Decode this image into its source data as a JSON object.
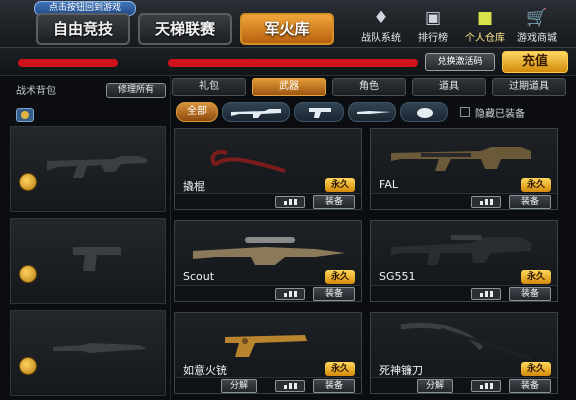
{
  "header": {
    "hint": "点击按钮回到游戏",
    "modes": [
      "自由竞技",
      "天梯联赛",
      "军火库"
    ],
    "nav": [
      {
        "label": "战队系统",
        "icon": "team-icon"
      },
      {
        "label": "排行榜",
        "icon": "ranking-icon"
      },
      {
        "label": "个人仓库",
        "icon": "warehouse-icon"
      },
      {
        "label": "游戏商城",
        "icon": "shop-cart-icon"
      }
    ]
  },
  "account": {
    "redeem_label": "兑换激活码",
    "recharge_label": "充值"
  },
  "backpack": {
    "title": "战术背包",
    "repair_label": "修理所有",
    "slots": [
      {
        "icon": "rifle-icon"
      },
      {
        "icon": "pistol-icon"
      },
      {
        "icon": "knife-icon"
      }
    ]
  },
  "tabs": {
    "categories": [
      "礼包",
      "武器",
      "角色",
      "道具",
      "过期道具"
    ],
    "all_label": "全部",
    "hide_equipped_label": "隐藏已装备"
  },
  "items": [
    {
      "name": "撬棍",
      "tag": "永久",
      "action": "装备"
    },
    {
      "name": "FAL",
      "tag": "永久",
      "action": "装备"
    },
    {
      "name": "Scout",
      "tag": "永久",
      "action": "装备"
    },
    {
      "name": "SG551",
      "tag": "永久",
      "action": "装备"
    },
    {
      "name": "如意火铳",
      "tag": "永久",
      "action": "装备",
      "secondary": "分解"
    },
    {
      "name": "死神镰刀",
      "tag": "永久",
      "action": "装备",
      "secondary": "分解"
    }
  ],
  "colors": {
    "accent_orange": "#e29a36",
    "gold_badge": "#ffd85c",
    "redaction": "#d0121a"
  }
}
